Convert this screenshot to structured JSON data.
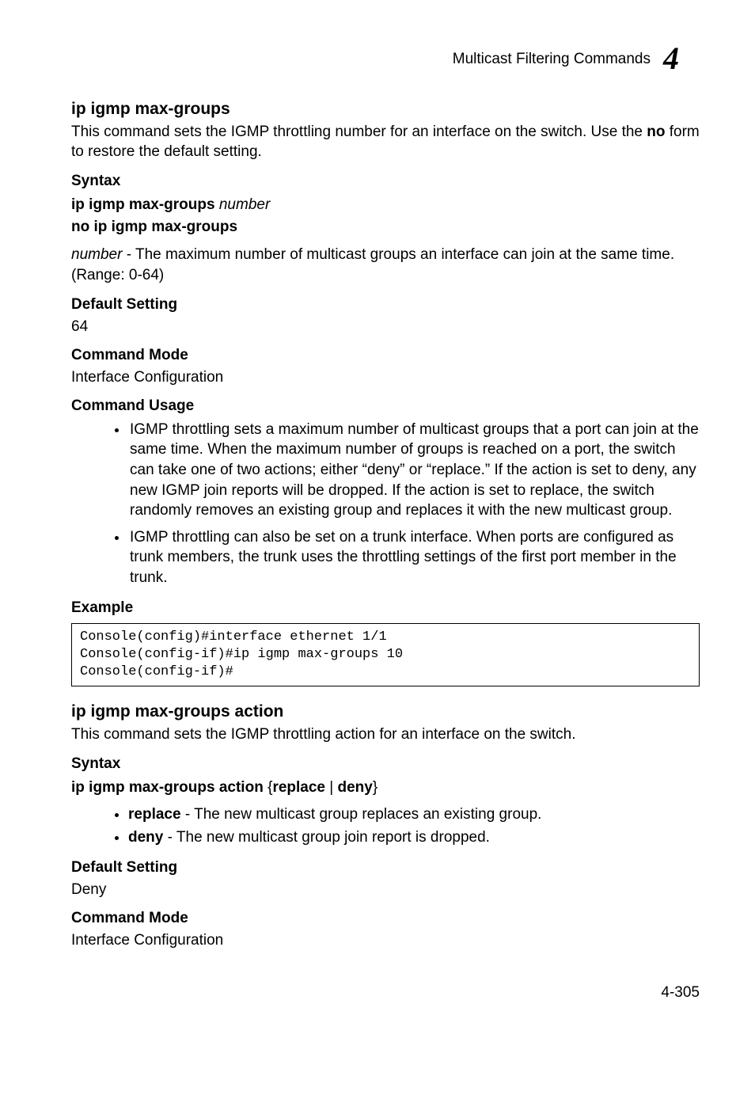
{
  "header": {
    "running_title": "Multicast Filtering Commands",
    "chapter_number": "4"
  },
  "cmd1": {
    "title": "ip igmp max-groups",
    "intro": "This command sets the IGMP throttling number for an interface on the switch. Use the ",
    "intro_bold": "no",
    "intro_tail": " form to restore the default setting.",
    "syntax_heading": "Syntax",
    "syntax_bold1": "ip igmp max-groups",
    "syntax_italic1": " number",
    "syntax_line2": "no ip igmp max-groups",
    "param_name": "number",
    "param_desc": " - The maximum number of multicast groups an interface can join at the same time. (Range: 0-64)",
    "default_heading": "Default Setting",
    "default_value": "64",
    "mode_heading": "Command Mode",
    "mode_value": "Interface Configuration",
    "usage_heading": "Command Usage",
    "usage_bullets": [
      "IGMP throttling sets a maximum number of multicast groups that a port can join at the same time. When the maximum number of groups is reached on a port, the switch can take one of two actions; either “deny” or “replace.” If the action is set to deny, any new IGMP join reports will be dropped. If the action is set to replace, the switch randomly removes an existing group and replaces it with the new multicast group.",
      "IGMP throttling can also be set on a trunk interface. When ports are configured as trunk members, the trunk uses the throttling settings of the first port member in the trunk."
    ],
    "example_heading": "Example",
    "example_code": "Console(config)#interface ethernet 1/1\nConsole(config-if)#ip igmp max-groups 10\nConsole(config-if)#"
  },
  "cmd2": {
    "title": "ip igmp max-groups action",
    "intro": "This command sets the IGMP throttling action for an interface on the switch.",
    "syntax_heading": "Syntax",
    "syntax_bold": "ip igmp max-groups action",
    "syntax_brace_open": " {",
    "syntax_opt1": "replace",
    "syntax_sep": " | ",
    "syntax_opt2": "deny",
    "syntax_brace_close": "}",
    "opts": [
      {
        "kw": "replace",
        "desc": " - The new multicast group replaces an existing group."
      },
      {
        "kw": "deny",
        "desc": " - The new multicast group join report is dropped."
      }
    ],
    "default_heading": "Default Setting",
    "default_value": "Deny",
    "mode_heading": "Command Mode",
    "mode_value": "Interface Configuration"
  },
  "footer": {
    "page_number": "4-305"
  }
}
